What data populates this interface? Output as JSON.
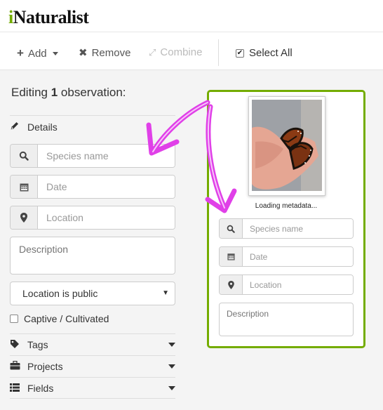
{
  "app": {
    "logo_initial": "i",
    "logo_rest": "Naturalist"
  },
  "toolbar": {
    "add_label": "Add",
    "remove_label": "Remove",
    "combine_label": "Combine",
    "select_all_label": "Select All"
  },
  "editor": {
    "title_prefix": "Editing",
    "count": "1",
    "title_suffix": "observation:",
    "details_label": "Details",
    "species_placeholder": "Species name",
    "date_placeholder": "Date",
    "location_placeholder": "Location",
    "description_placeholder": "Description",
    "geoprivacy_value": "Location is public",
    "captive_label": "Captive / Cultivated",
    "tags_label": "Tags",
    "projects_label": "Projects",
    "fields_label": "Fields"
  },
  "card": {
    "status_text": "Loading metadata...",
    "species_placeholder": "Species name",
    "date_placeholder": "Date",
    "location_placeholder": "Location",
    "description_placeholder": "Description"
  },
  "colors": {
    "accent_green": "#74ac00",
    "arrow_magenta": "#e040e8"
  },
  "icons": [
    "plus-icon",
    "caret-down-icon",
    "x-icon",
    "combine-icon",
    "checkbox-icon",
    "pencil-icon",
    "search-icon",
    "calendar-icon",
    "map-marker-icon",
    "tag-icon",
    "briefcase-icon",
    "list-icon"
  ]
}
